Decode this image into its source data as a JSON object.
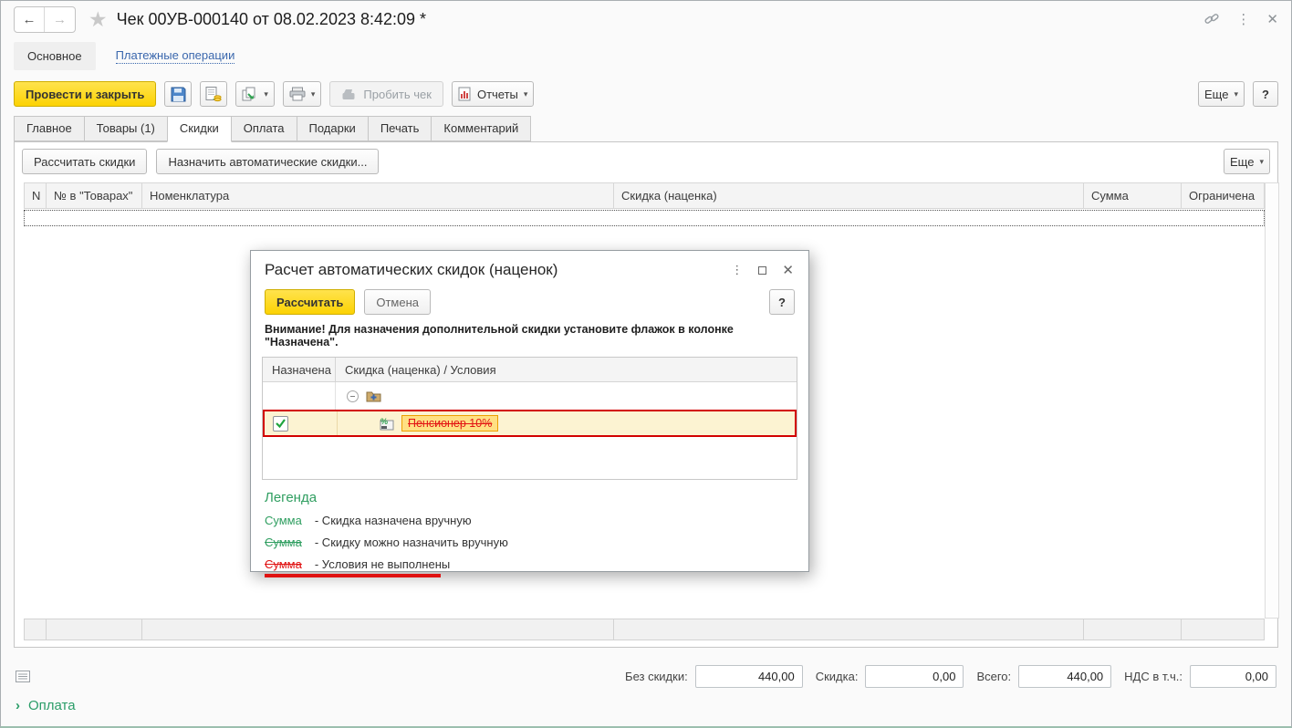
{
  "app": {
    "title": "Чек 00УВ-000140 от 08.02.2023 8:42:09 *",
    "nav": {
      "main": "Основное",
      "payments": "Платежные операции"
    },
    "toolbar": {
      "post_and_close": "Провести и закрыть",
      "fiscal_check": "Пробить чек",
      "reports": "Отчеты",
      "more": "Еще",
      "help": "?"
    },
    "tabs": [
      "Главное",
      "Товары (1)",
      "Скидки",
      "Оплата",
      "Подарки",
      "Печать",
      "Комментарий"
    ],
    "commands": {
      "calculate": "Рассчитать скидки",
      "assign_auto": "Назначить автоматические скидки...",
      "more": "Еще"
    },
    "table": {
      "columns": [
        "N",
        "№ в \"Товарах\"",
        "Номенклатура",
        "Скидка (наценка)",
        "Сумма",
        "Ограничена"
      ]
    },
    "totals": [
      {
        "label": "Без скидки:",
        "value": "440,00"
      },
      {
        "label": "Скидка:",
        "value": "0,00"
      },
      {
        "label": "Всего:",
        "value": "440,00"
      },
      {
        "label": "НДС в т.ч.:",
        "value": "0,00"
      }
    ],
    "footer_group": "Оплата"
  },
  "dialog": {
    "title": "Расчет автоматических скидок (наценок)",
    "buttons": {
      "calculate": "Рассчитать",
      "cancel": "Отмена",
      "help": "?"
    },
    "warning": "Внимание! Для назначения дополнительной скидки установите флажок в колонке \"Назначена\".",
    "table": {
      "columns": [
        "Назначена",
        "Скидка (наценка) / Условия"
      ],
      "discount_name": "Пенсионер 10%",
      "discount_checked": true
    },
    "legend": {
      "title": "Легенда",
      "items": [
        {
          "sample": "Сумма",
          "text": "- Скидка назначена вручную"
        },
        {
          "sample": "Сумма",
          "text": "- Скидку можно назначить вручную"
        },
        {
          "sample": "Сумма",
          "text": "- Условия не выполнены"
        }
      ]
    }
  },
  "colors": {
    "accent_yellow": "#ffd800",
    "green": "#2f9e60",
    "red": "#e01212",
    "link_blue": "#3a67ad",
    "selected_row_bg": "#fcf3d2",
    "highlight_bg": "#ffe083"
  }
}
